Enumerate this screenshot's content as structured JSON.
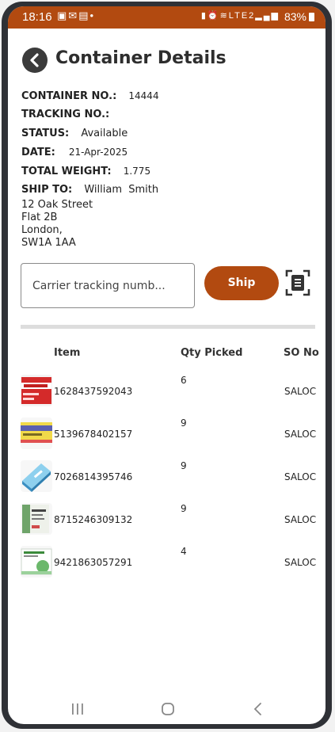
{
  "status_bar": {
    "time": "18:16",
    "notification_icons": [
      "image-icon",
      "mail-icon",
      "teams-icon",
      "dot-icon"
    ],
    "system_icons": [
      "battery-saver-icon",
      "alarm-icon",
      "wifi-icon",
      "signal-icon"
    ],
    "network_label": "LTE2",
    "battery": "83%"
  },
  "header": {
    "title": "Container Details"
  },
  "details": {
    "container_no_label": "CONTAINER NO.:",
    "container_no": "14444",
    "tracking_no_label": "TRACKING NO.:",
    "tracking_no": "",
    "status_label": "STATUS:",
    "status": "Available",
    "date_label": "DATE:",
    "date": "21-Apr-2025",
    "total_weight_label": "TOTAL WEIGHT:",
    "total_weight": "1.775",
    "ship_to_label": "SHIP TO:",
    "ship_to": "William  Smith",
    "address": [
      "12 Oak Street",
      "Flat 2B",
      "London,",
      "SW1A 1AA"
    ]
  },
  "actions": {
    "tracking_placeholder": "Carrier tracking numb...",
    "ship_label": "Ship"
  },
  "table": {
    "headers": {
      "item": "Item",
      "qty": "Qty Picked",
      "so": "SO No"
    },
    "rows": [
      {
        "code": "1628437592043",
        "qty": "6",
        "so": "SALOC",
        "thumb": "ibuprofen-box"
      },
      {
        "code": "5139678402157",
        "qty": "9",
        "so": "SALOC",
        "thumb": "tablets-box-yellow"
      },
      {
        "code": "7026814395746",
        "qty": "9",
        "so": "SALOC",
        "thumb": "tablets-box-blue"
      },
      {
        "code": "8715246309132",
        "qty": "9",
        "so": "SALOC",
        "thumb": "tablets-box-green"
      },
      {
        "code": "9421863057291",
        "qty": "4",
        "so": "SALOC",
        "thumb": "tablets-box-white"
      }
    ]
  },
  "colors": {
    "accent": "#b24a10",
    "text": "#222222",
    "divider": "#dddddd"
  }
}
